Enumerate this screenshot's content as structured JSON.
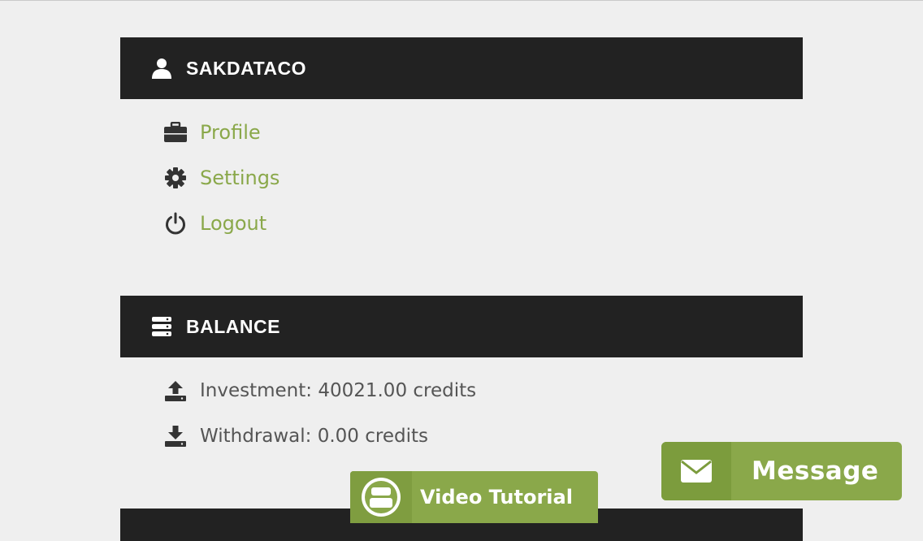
{
  "user": {
    "username": "SAKDATACO",
    "menu": [
      {
        "label": "Profile",
        "icon": "briefcase-icon"
      },
      {
        "label": "Settings",
        "icon": "gear-icon"
      },
      {
        "label": "Logout",
        "icon": "power-icon"
      }
    ]
  },
  "balance": {
    "title": "BALANCE",
    "investment": "Investment: 40021.00 credits",
    "withdrawal": "Withdrawal: 0.00 credits"
  },
  "buttons": {
    "video_tutorial": "Video Tutorial",
    "message": "Message"
  },
  "colors": {
    "header_bg": "#222222",
    "accent_green": "#8aa84a",
    "page_bg": "#efefef",
    "text_gray": "#555555"
  }
}
